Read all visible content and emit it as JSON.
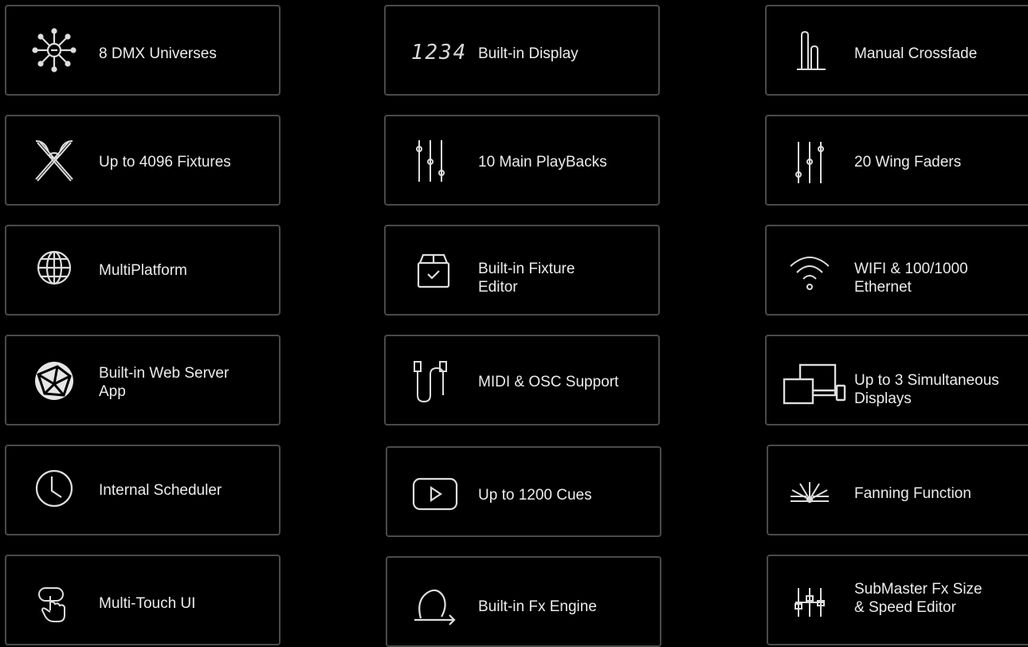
{
  "features": {
    "col1": [
      {
        "label": "8 DMX Universes",
        "icon": "network-hub-icon"
      },
      {
        "label": "Up to 4096 Fixtures",
        "icon": "crossed-fixtures-icon"
      },
      {
        "label": "MultiPlatform",
        "icon": "globe-icon"
      },
      {
        "label": "Built-in Web Server\nApp",
        "icon": "web-sphere-icon"
      },
      {
        "label": "Internal Scheduler",
        "icon": "clock-icon"
      },
      {
        "label": "Multi-Touch UI",
        "icon": "touch-hand-icon"
      }
    ],
    "col2": [
      {
        "label": "Built-in Display",
        "icon": "seven-segment-display-icon",
        "digits": "1234"
      },
      {
        "label": "10 Main PlayBacks",
        "icon": "faders-icon"
      },
      {
        "label": "Built-in Fixture\nEditor",
        "icon": "fixture-box-icon"
      },
      {
        "label": "MIDI & OSC Support",
        "icon": "midi-cable-icon"
      },
      {
        "label": "Up to 1200 Cues",
        "icon": "play-button-icon"
      },
      {
        "label": "Built-in Fx Engine",
        "icon": "loop-arrow-icon"
      }
    ],
    "col3": [
      {
        "label": "Manual Crossfade",
        "icon": "crossfade-icon"
      },
      {
        "label": "20 Wing Faders",
        "icon": "wing-faders-icon"
      },
      {
        "label": "WIFI & 100/1000\nEthernet",
        "icon": "wifi-icon"
      },
      {
        "label": "Up to 3 Simultaneous\nDisplays",
        "icon": "multi-display-icon"
      },
      {
        "label": "Fanning Function",
        "icon": "fanning-icon"
      },
      {
        "label": "SubMaster Fx Size\n& Speed Editor",
        "icon": "submaster-faders-icon"
      }
    ]
  }
}
